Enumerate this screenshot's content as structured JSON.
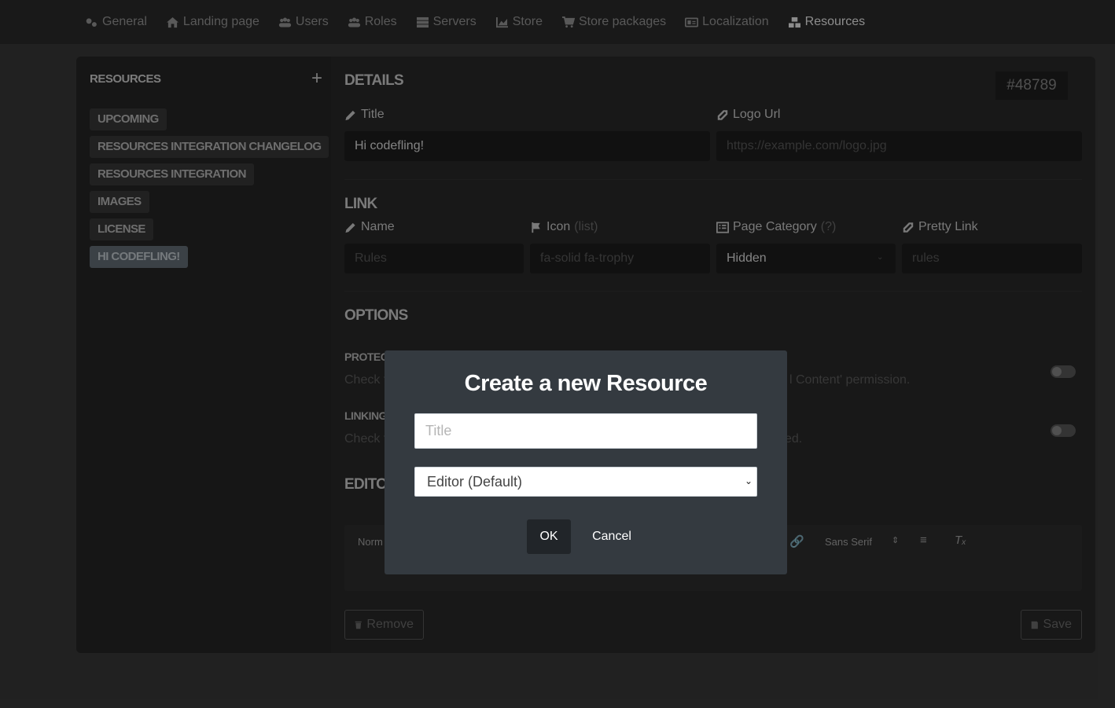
{
  "nav": {
    "items": [
      {
        "label": "General",
        "icon": "gears-icon"
      },
      {
        "label": "Landing page",
        "icon": "home-icon"
      },
      {
        "label": "Users",
        "icon": "users-icon"
      },
      {
        "label": "Roles",
        "icon": "users-gear-icon"
      },
      {
        "label": "Servers",
        "icon": "server-icon"
      },
      {
        "label": "Store",
        "icon": "chart-area-icon"
      },
      {
        "label": "Store packages",
        "icon": "cart-icon"
      },
      {
        "label": "Localization",
        "icon": "language-icon"
      },
      {
        "label": "Resources",
        "icon": "boxes-icon"
      }
    ],
    "active": "Resources"
  },
  "sidebar": {
    "title": "RESOURCES",
    "add_label": "+",
    "items": [
      {
        "label": "UPCOMING"
      },
      {
        "label": "RESOURCES INTEGRATION CHANGELOG"
      },
      {
        "label": "RESOURCES INTEGRATION"
      },
      {
        "label": "IMAGES"
      },
      {
        "label": "LICENSE"
      },
      {
        "label": "HI CODEFLING!"
      }
    ],
    "active_index": 5
  },
  "details": {
    "section_title": "DETAILS",
    "id": "#48789",
    "title_label": "Title",
    "title_value": "Hi codefling!",
    "logo_label": "Logo Url",
    "logo_placeholder": "https://example.com/logo.jpg"
  },
  "link": {
    "section_title": "LINK",
    "name_label": "Name",
    "name_placeholder": "Rules",
    "icon_label": "Icon",
    "icon_hint": "(list)",
    "icon_placeholder": "fa-solid fa-trophy",
    "category_label": "Page Category",
    "category_hint": "(?)",
    "category_value": "Hidden",
    "pretty_label": "Pretty Link",
    "pretty_placeholder": "rules"
  },
  "options": {
    "section_title": "OPTIONS",
    "protected_title": "PROTEC",
    "protected_desc_left": "Check t",
    "protected_desc_right": "l Content' permission.",
    "linking_title": "LINKING",
    "linking_desc_left": "Check t",
    "linking_desc_right": "ed."
  },
  "editor": {
    "section_title": "EDITO",
    "format_label": "Norm",
    "font_label": "Sans Serif"
  },
  "actions": {
    "remove_label": "Remove",
    "save_label": "Save"
  },
  "modal": {
    "title": "Create a new Resource",
    "title_placeholder": "Title",
    "type_value": "Editor (Default)",
    "ok_label": "OK",
    "cancel_label": "Cancel"
  }
}
